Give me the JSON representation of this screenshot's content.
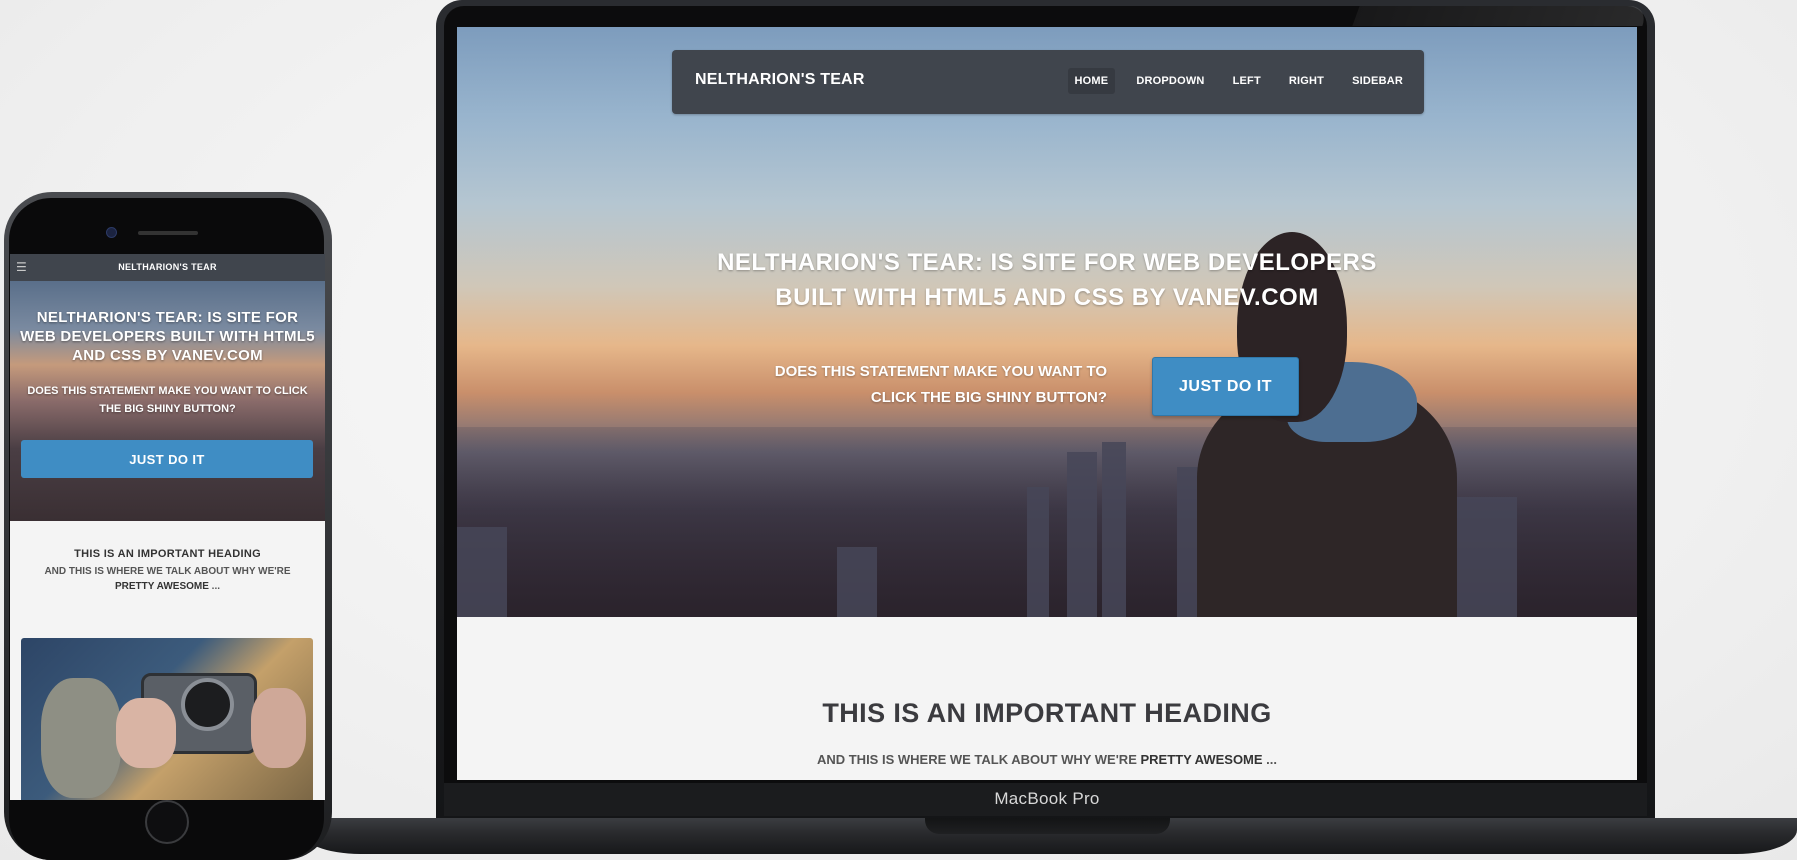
{
  "laptop": {
    "label": "MacBook Pro",
    "site": {
      "brand": "NELTHARION'S TEAR",
      "nav": [
        {
          "label": "HOME",
          "active": true
        },
        {
          "label": "DROPDOWN",
          "active": false
        },
        {
          "label": "LEFT",
          "active": false
        },
        {
          "label": "RIGHT",
          "active": false
        },
        {
          "label": "SIDEBAR",
          "active": false
        }
      ],
      "hero": {
        "title_line1": "NELTHARION'S TEAR: IS SITE FOR WEB DEVELOPERS",
        "title_line2": "BUILT WITH HTML5 AND CSS BY VANEV.COM",
        "question_line1": "DOES THIS STATEMENT MAKE YOU WANT TO",
        "question_line2": "CLICK THE BIG SHINY BUTTON?",
        "button": "JUST DO IT"
      },
      "section": {
        "heading": "THIS IS AN IMPORTANT HEADING",
        "sub_prefix": "AND THIS IS WHERE WE TALK ABOUT WHY WE'RE ",
        "sub_bold": "PRETTY AWESOME",
        "sub_suffix": " ..."
      }
    }
  },
  "phone": {
    "menu_icon": "hamburger-icon",
    "brand": "NELTHARION'S TEAR",
    "hero": {
      "title": "NELTHARION'S TEAR: IS SITE FOR WEB DEVELOPERS BUILT WITH HTML5 AND CSS BY VANEV.COM",
      "question": "DOES THIS STATEMENT MAKE YOU WANT TO CLICK THE BIG SHINY BUTTON?",
      "button": "JUST DO IT"
    },
    "section": {
      "heading": "THIS IS AN IMPORTANT HEADING",
      "sub_prefix": "AND THIS IS WHERE WE TALK ABOUT WHY WE'RE ",
      "sub_bold": "PRETTY AWESOME",
      "sub_suffix": " ..."
    }
  },
  "colors": {
    "navbar": "#40454d",
    "button": "#3f8dc4",
    "heading": "#3b3b3f"
  }
}
